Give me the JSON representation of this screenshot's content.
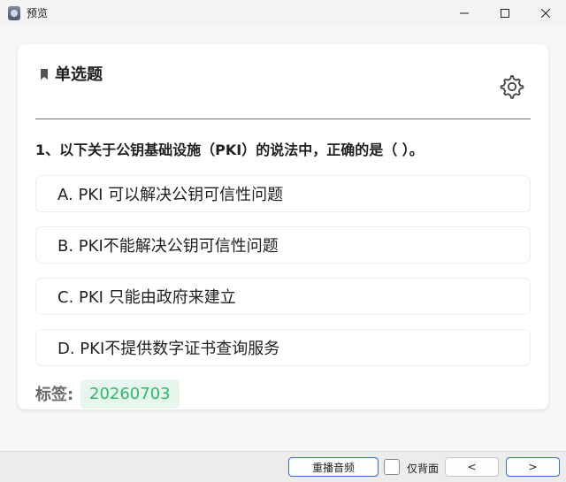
{
  "window": {
    "title": "预览"
  },
  "card": {
    "type_title": "单选题",
    "question": "1、以下关于公钥基础设施（PKI）的说法中，正确的是（ ）。",
    "options": [
      {
        "label": "A. PKI 可以解决公钥可信性问题"
      },
      {
        "label": "B. PKI不能解决公钥可信性问题"
      },
      {
        "label": "C. PKI 只能由政府来建立"
      },
      {
        "label": "D. PKI不提供数字证书查询服务"
      }
    ],
    "tag_label": "标签:",
    "tag_value": "20260703"
  },
  "bottombar": {
    "replay_label": "重播音频",
    "back_only_label": "仅背面",
    "back_only_checked": false,
    "prev_label": "<",
    "next_label": ">"
  },
  "icons": {
    "app": "app-icon",
    "bookmark": "bookmark-icon",
    "settings": "gear-icon",
    "minimize": "minimize-icon",
    "maximize": "maximize-icon",
    "close": "close-icon"
  },
  "colors": {
    "tag_text": "#2fb86a",
    "tag_background": "#e7f6ec",
    "primary_border": "#2f6fd6"
  }
}
